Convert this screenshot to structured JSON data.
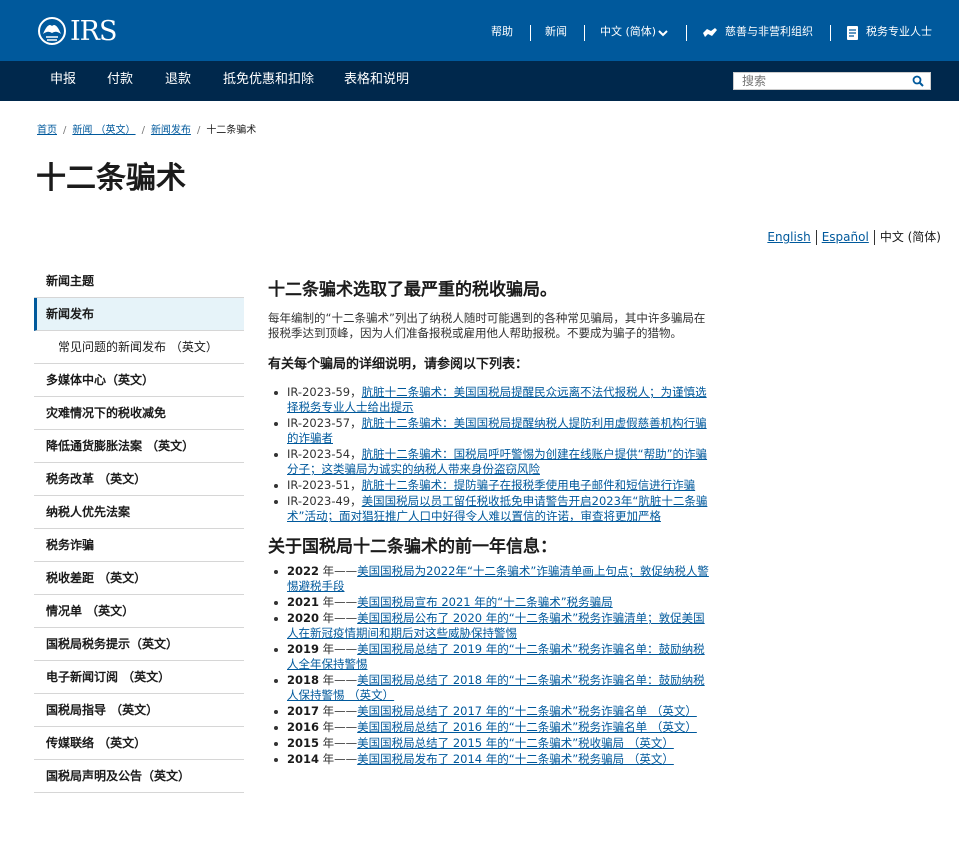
{
  "header": {
    "logo_text": "IRS",
    "util": {
      "help": "帮助",
      "news": "新闻",
      "language": "中文 (简体)",
      "charities": "慈善与非营利组织",
      "tax_pros": "税务专业人士"
    }
  },
  "nav": {
    "items": [
      "申报",
      "付款",
      "退款",
      "抵免优惠和扣除",
      "表格和说明"
    ],
    "search_placeholder": "搜索"
  },
  "breadcrumb": {
    "items": [
      "首页",
      "新闻 （英文）",
      "新闻发布"
    ],
    "current": "十二条骗术"
  },
  "page_title": "十二条骗术",
  "languages": {
    "english": "English",
    "spanish": "Español",
    "chinese": "中文 (简体)"
  },
  "sidebar": {
    "items": [
      "新闻主题",
      "新闻发布",
      "常见问题的新闻发布 （英文）",
      "多媒体中心（英文）",
      "灾难情况下的税收减免",
      "降低通货膨胀法案 （英文）",
      "税务改革 （英文）",
      "纳税人优先法案",
      "税务诈骗",
      "税收差距 （英文）",
      "情况单 （英文）",
      "国税局税务提示（英文）",
      "电子新闻订阅 （英文）",
      "国税局指导 （英文）",
      "传媒联络 （英文）",
      "国税局声明及公告（英文）"
    ]
  },
  "main": {
    "heading": "十二条骗术选取了最严重的税收骗局。",
    "intro": "每年编制的“十二条骗术”列出了纳税人随时可能遇到的各种常见骗局，其中许多骗局在报税季达到顶峰，因为人们准备报税或雇用他人帮助报税。不要成为骗子的猎物。",
    "list_heading": "有关每个骗局的详细说明，请参阅以下列表：",
    "releases": [
      {
        "id": "IR-2023-59，",
        "link": "肮脏十二条骗术：美国国税局提醒民众远离不法代报税人；为谨慎选择税务专业人士给出提示"
      },
      {
        "id": "IR-2023-57，",
        "link": "肮脏十二条骗术：美国国税局提醒纳税人提防利用虚假慈善机构行骗的诈骗者"
      },
      {
        "id": "IR-2023-54，",
        "link": "肮脏十二条骗术：国税局呼吁警惕为创建在线账户提供“帮助”的诈骗分子；这类骗局为诚实的纳税人带来身份盗窃风险"
      },
      {
        "id": "IR-2023-51，",
        "link": "肮脏十二条骗术：提防骗子在报税季使用电子邮件和短信进行诈骗"
      },
      {
        "id": "IR-2023-49，",
        "link": "美国国税局以员工留任税收抵免申请警告开启2023年“肮脏十二条骗术”活动；面对猖狂推广人口中好得令人难以置信的许诺，审查将更加严格"
      }
    ],
    "prior_heading": "关于国税局十二条骗术的前一年信息：",
    "prior": [
      {
        "year": "2022",
        "suffix": " 年——",
        "link": "美国国税局为2022年“十二条骗术”诈骗清单画上句点；敦促纳税人警惕避税手段"
      },
      {
        "year": "2021",
        "suffix": " 年——",
        "link": "美国国税局宣布 2021 年的“十二条骗术”税务骗局"
      },
      {
        "year": "2020",
        "suffix": " 年——",
        "link": "美国国税局公布了 2020 年的“十二条骗术”税务诈骗清单；敦促美国人在新冠疫情期间和期后对这些威胁保持警惕"
      },
      {
        "year": "2019",
        "suffix": " 年——",
        "link": "美国国税局总结了 2019 年的“十二条骗术”税务诈骗名单：鼓励纳税人全年保持警惕"
      },
      {
        "year": "2018",
        "suffix": " 年——",
        "link": "美国国税局总结了 2018 年的“十二条骗术”税务诈骗名单：鼓励纳税人保持警惕 （英文）"
      },
      {
        "year": "2017",
        "suffix": " 年——",
        "link": "美国国税局总结了 2017 年的“十二条骗术”税务诈骗名单 （英文）"
      },
      {
        "year": "2016",
        "suffix": " 年——",
        "link": "美国国税局总结了 2016 年的“十二条骗术”税务诈骗名单 （英文）"
      },
      {
        "year": "2015",
        "suffix": " 年——",
        "link": "美国国税局总结了 2015 年的“十二条骗术”税收骗局 （英文）"
      },
      {
        "year": "2014",
        "suffix": " 年——",
        "link": "美国国税局发布了 2014 年的“十二条骗术”税务骗局 （英文）"
      }
    ]
  },
  "colors": {
    "header_blue": "#00599c",
    "nav_dark": "#00284c",
    "link": "#00599c",
    "active_bg": "#e6f3f9"
  },
  "icons": [
    "eagle-logo",
    "chevron-down-icon",
    "handshake-icon",
    "document-icon",
    "search-icon"
  ]
}
